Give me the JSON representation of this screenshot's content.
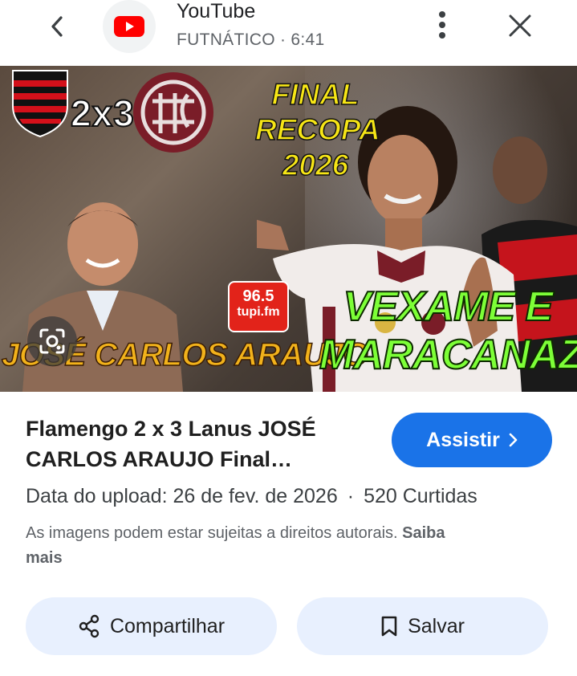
{
  "header": {
    "app_name": "YouTube",
    "subtitle": "FUTNÁTICO · 6:41",
    "icons": {
      "back": "chevron-left-icon",
      "logo": "youtube-logo-icon",
      "more": "more-vert-icon",
      "close": "close-icon"
    }
  },
  "thumbnail": {
    "score": "2x3",
    "final_text": [
      "FINAL",
      "RECOPA",
      "2026"
    ],
    "radio": [
      "96.5",
      "tupi.fm"
    ],
    "name": "JOSÉ CARLOS ARAUJO",
    "headline": [
      "VEXAME E",
      "MARACANAZO"
    ],
    "lens_icon": "google-lens-icon"
  },
  "result": {
    "title_line1": "Flamengo 2 x 3 Lanus JOSÉ",
    "title_line2": "CARLOS ARAUJO Final…",
    "watch_label": "Assistir",
    "upload": "Data do upload: 26 de fev. de 2026",
    "likes": "520 Curtidas",
    "copyright_text": "As imagens podem estar sujeitas a direitos autorais.",
    "learn_more_1": "Saiba",
    "learn_more_2": "mais"
  },
  "actions": {
    "share_label": "Compartilhar",
    "save_label": "Salvar"
  },
  "colors": {
    "accent": "#1a73e8",
    "pill_bg": "#e8f0fe",
    "youtube_red": "#ff0000"
  }
}
